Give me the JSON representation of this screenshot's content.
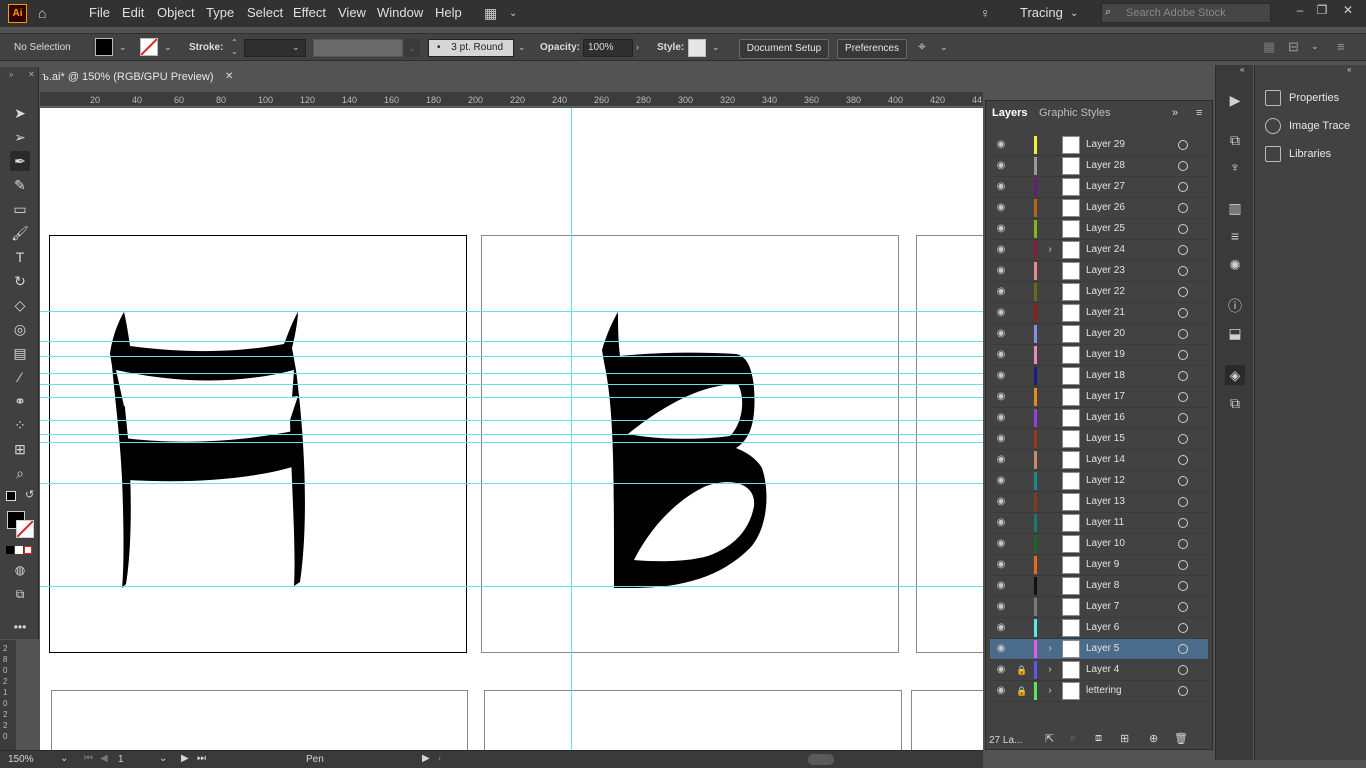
{
  "app": {
    "logo": "Ai"
  },
  "menubar": {
    "items": [
      "File",
      "Edit",
      "Object",
      "Type",
      "Select",
      "Effect",
      "View",
      "Window",
      "Help"
    ],
    "workspace": "Tracing",
    "search_placeholder": "Search Adobe Stock"
  },
  "controlbar": {
    "selection": "No Selection",
    "stroke_label": "Stroke:",
    "brush": "3 pt. Round",
    "opacity_label": "Opacity:",
    "opacity_value": "100%",
    "style_label": "Style:",
    "document_setup": "Document Setup",
    "preferences": "Preferences"
  },
  "document": {
    "tab_title": "ъ.ai* @ 150% (RGB/GPU Preview)",
    "close": "✕"
  },
  "ruler": {
    "h_ticks": [
      "20",
      "40",
      "60",
      "80",
      "100",
      "120",
      "140",
      "160",
      "180",
      "200",
      "220",
      "240",
      "260",
      "280",
      "300",
      "320",
      "340",
      "360",
      "380",
      "400",
      "420",
      "44"
    ],
    "v_ticks": [
      "2",
      "8",
      "0",
      "2",
      "1",
      "0",
      "2",
      "2",
      "0"
    ]
  },
  "status": {
    "zoom": "150%",
    "artboard": "1",
    "tool": "Pen"
  },
  "layers_panel": {
    "tabs": [
      "Layers",
      "Graphic Styles"
    ],
    "count": "27 La...",
    "layers": [
      {
        "name": "Layer 29",
        "color": "#f2f23c",
        "expand": false,
        "locked": false,
        "selected": false
      },
      {
        "name": "Layer 28",
        "color": "#9a9a9a",
        "expand": false,
        "locked": false,
        "selected": false
      },
      {
        "name": "Layer 27",
        "color": "#6a1a7a",
        "expand": false,
        "locked": false,
        "selected": false
      },
      {
        "name": "Layer 26",
        "color": "#b3661a",
        "expand": false,
        "locked": false,
        "selected": false
      },
      {
        "name": "Layer 25",
        "color": "#8ab31a",
        "expand": false,
        "locked": false,
        "selected": false
      },
      {
        "name": "Layer 24",
        "color": "#8a1a3a",
        "expand": true,
        "locked": false,
        "selected": false
      },
      {
        "name": "Layer 23",
        "color": "#e88a8a",
        "expand": false,
        "locked": false,
        "selected": false
      },
      {
        "name": "Layer 22",
        "color": "#6a6a1a",
        "expand": false,
        "locked": false,
        "selected": false
      },
      {
        "name": "Layer 21",
        "color": "#9a1a1a",
        "expand": false,
        "locked": false,
        "selected": false
      },
      {
        "name": "Layer 20",
        "color": "#8a8ae8",
        "expand": false,
        "locked": false,
        "selected": false
      },
      {
        "name": "Layer 19",
        "color": "#e88ab3",
        "expand": false,
        "locked": false,
        "selected": false
      },
      {
        "name": "Layer 18",
        "color": "#1a1a8a",
        "expand": false,
        "locked": false,
        "selected": false
      },
      {
        "name": "Layer 17",
        "color": "#e88a1a",
        "expand": false,
        "locked": false,
        "selected": false
      },
      {
        "name": "Layer 16",
        "color": "#9a3ae8",
        "expand": false,
        "locked": false,
        "selected": false
      },
      {
        "name": "Layer 15",
        "color": "#9a3a1a",
        "expand": false,
        "locked": false,
        "selected": false
      },
      {
        "name": "Layer 14",
        "color": "#c88a6a",
        "expand": false,
        "locked": false,
        "selected": false
      },
      {
        "name": "Layer 12",
        "color": "#1a8a8a",
        "expand": false,
        "locked": false,
        "selected": false
      },
      {
        "name": "Layer 13",
        "color": "#8a3a1a",
        "expand": false,
        "locked": false,
        "selected": false
      },
      {
        "name": "Layer 11",
        "color": "#1a7a7a",
        "expand": false,
        "locked": false,
        "selected": false
      },
      {
        "name": "Layer 10",
        "color": "#1a6a1a",
        "expand": false,
        "locked": false,
        "selected": false
      },
      {
        "name": "Layer 9",
        "color": "#e86a1a",
        "expand": false,
        "locked": false,
        "selected": false
      },
      {
        "name": "Layer 8",
        "color": "#111111",
        "expand": false,
        "locked": false,
        "selected": false
      },
      {
        "name": "Layer 7",
        "color": "#7a7a7a",
        "expand": false,
        "locked": false,
        "selected": false
      },
      {
        "name": "Layer 6",
        "color": "#5ae8e8",
        "expand": false,
        "locked": false,
        "selected": false
      },
      {
        "name": "Layer 5",
        "color": "#e85ae8",
        "expand": true,
        "locked": false,
        "selected": true
      },
      {
        "name": "Layer 4",
        "color": "#5a5ae8",
        "expand": true,
        "locked": true,
        "selected": false
      },
      {
        "name": "lettering",
        "color": "#5ae85a",
        "expand": true,
        "locked": true,
        "selected": false
      }
    ]
  },
  "properties_panel": {
    "items": [
      "Properties",
      "Image Trace",
      "Libraries"
    ]
  },
  "colors": {
    "guide": "#5ee6e6",
    "selected_row": "#4b6b8a",
    "accent": "#ff9a00"
  }
}
